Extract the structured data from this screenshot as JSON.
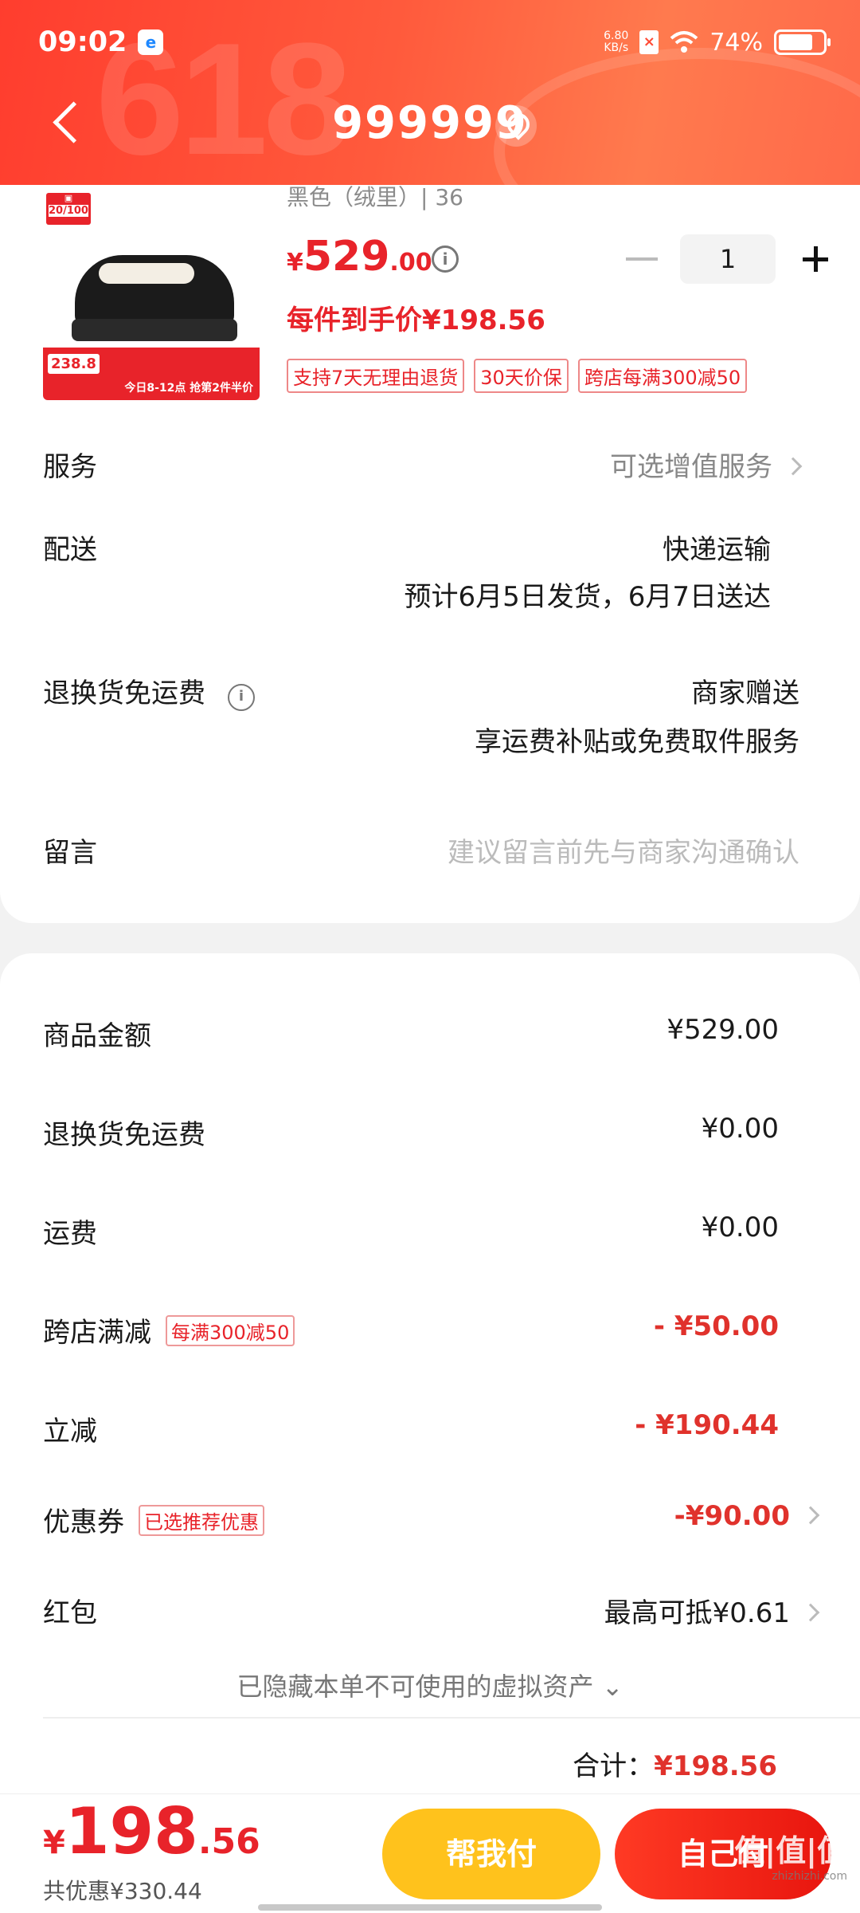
{
  "status": {
    "time": "09:02",
    "speed_top": "6.80",
    "speed_bottom": "KB/s",
    "battery": "74%"
  },
  "header": {
    "title": "999999",
    "bg_text": "618"
  },
  "product": {
    "sku": "黑色（绒里）| 36",
    "price_symbol": "¥",
    "price_int": "529",
    "price_dec": ".00",
    "quantity": "1",
    "unit_price": "每件到手价¥198.56",
    "badges": [
      "支持7天无理由退货",
      "30天价保",
      "跨店每满300减50"
    ],
    "image": {
      "tag_top": "20/100",
      "promo_price": "238.8",
      "promo_text": "今日8-12点 抢第2件半价"
    }
  },
  "rows": {
    "service": {
      "label": "服务",
      "value": "可选增值服务"
    },
    "delivery": {
      "label": "配送",
      "value": "快递运输",
      "sub": "预计6月5日发货，6月7日送达"
    },
    "return_fee": {
      "label": "退换货免运费",
      "value": "商家赠送",
      "sub": "享运费补贴或免费取件服务"
    },
    "message": {
      "label": "留言",
      "placeholder": "建议留言前先与商家沟通确认"
    }
  },
  "summary": {
    "goods": {
      "label": "商品金额",
      "value": "¥529.00"
    },
    "return_fee": {
      "label": "退换货免运费",
      "value": "¥0.00"
    },
    "shipping": {
      "label": "运费",
      "value": "¥0.00"
    },
    "cross_store": {
      "label": "跨店满减",
      "badge": "每满300减50",
      "value": "- ¥50.00"
    },
    "instant": {
      "label": "立减",
      "value": "- ¥190.44"
    },
    "coupon": {
      "label": "优惠券",
      "badge": "已选推荐优惠",
      "value": "-¥90.00"
    },
    "redpacket": {
      "label": "红包",
      "value": "最高可抵¥0.61"
    },
    "hidden_note": "已隐藏本单不可使用的虚拟资产",
    "total_label": "合计：",
    "total_value": "¥198.56"
  },
  "bottom": {
    "price_symbol": "¥",
    "price_int": "198",
    "price_dec": ".56",
    "saved": "共优惠¥330.44",
    "help_pay": "帮我付",
    "self_pay": "自己付",
    "watermark": "值|值|值",
    "watermark_site": "zhizhizhi.com"
  },
  "colors": {
    "accent": "#e8232a",
    "header": "#ff5a3c",
    "help_button": "#ffc21c"
  }
}
